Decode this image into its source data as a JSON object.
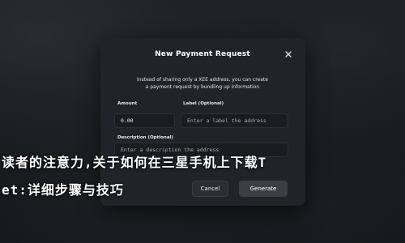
{
  "modal": {
    "title": "New Payment Request",
    "description_lines": [
      "Instead of sharing only a XEE address, you can create",
      "a payment request by bundling up information"
    ],
    "amount": {
      "label": "Amount",
      "value": "0.00"
    },
    "label_field": {
      "label": "Label (Optional)",
      "placeholder": "Enter a label the address"
    },
    "description": {
      "label": "Description (Optional)",
      "placeholder": "Enter a description the address"
    },
    "buttons": {
      "cancel": "Cancel",
      "generate": "Generate"
    }
  },
  "overlay": {
    "line1": "读者的注意力,关于如何在三星手机上下载T",
    "line2": "et:详细步骤与技巧"
  },
  "colors": {
    "modal_bg": "#212428",
    "input_bg": "#1a1c1f",
    "generate_bg": "#3b3f45"
  }
}
